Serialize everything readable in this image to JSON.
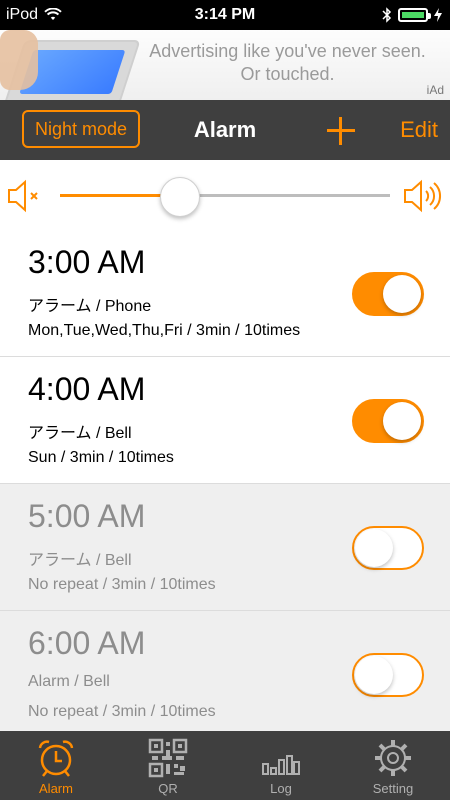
{
  "status": {
    "carrier": "iPod",
    "time": "3:14 PM"
  },
  "ad": {
    "text_line1": "Advertising like you've never seen.",
    "text_line2": "Or touched.",
    "label": "iAd"
  },
  "nav": {
    "night_mode_label": "Night mode",
    "title": "Alarm",
    "edit_label": "Edit"
  },
  "volume": {
    "level": 0.36
  },
  "alarms": [
    {
      "time": "3:00 AM",
      "sound": "アラーム / Phone",
      "repeat": "Mon,Tue,Wed,Thu,Fri / 3min / 10times",
      "enabled": true
    },
    {
      "time": "4:00 AM",
      "sound": "アラーム / Bell",
      "repeat": "Sun / 3min / 10times",
      "enabled": true
    },
    {
      "time": "5:00 AM",
      "sound": "アラーム / Bell",
      "repeat": "No repeat / 3min / 10times",
      "enabled": false
    },
    {
      "time": "6:00 AM",
      "sound": "Alarm / Bell",
      "repeat": "No repeat / 3min / 10times",
      "enabled": false
    }
  ],
  "tabs": [
    {
      "label": "Alarm",
      "icon": "alarm-clock-icon",
      "active": true
    },
    {
      "label": "QR",
      "icon": "qr-code-icon",
      "active": false
    },
    {
      "label": "Log",
      "icon": "bar-chart-icon",
      "active": false
    },
    {
      "label": "Setting",
      "icon": "gear-icon",
      "active": false
    }
  ],
  "colors": {
    "accent": "#ff8c00",
    "navbar": "#3f3f3f",
    "disabled_row": "#efefef"
  }
}
